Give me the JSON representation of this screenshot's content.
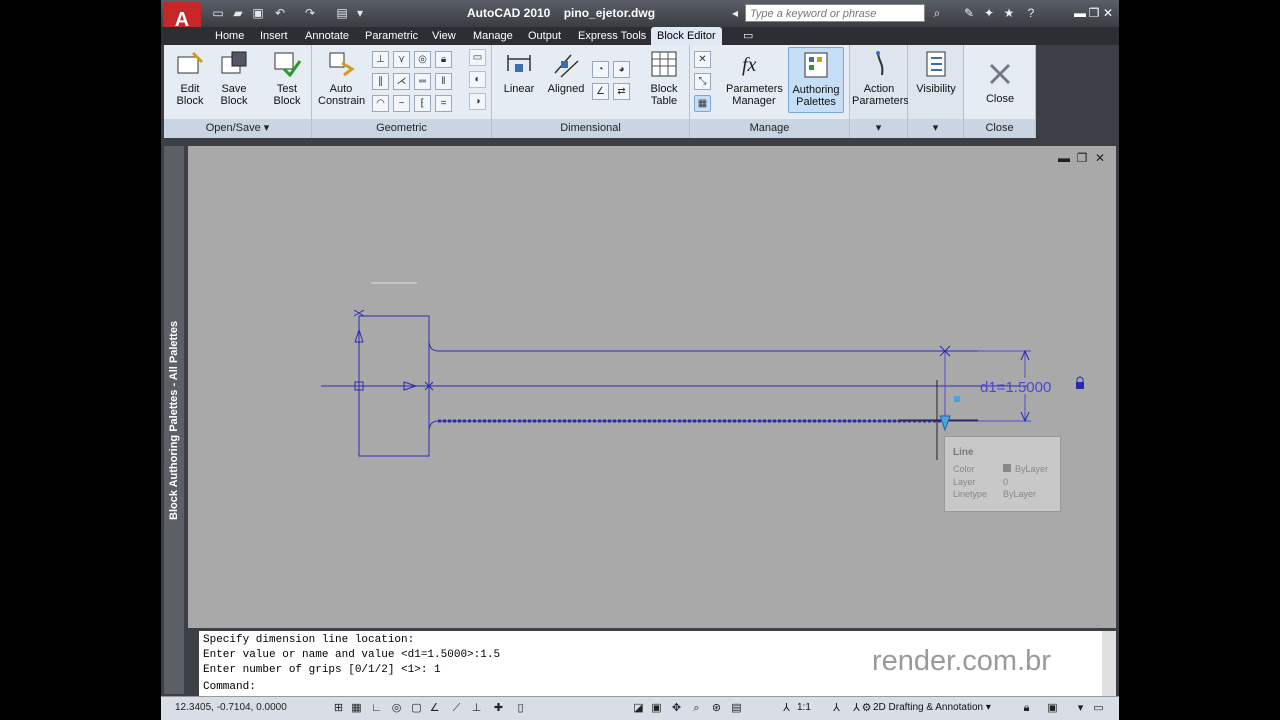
{
  "window": {
    "app_name": "AutoCAD 2010",
    "file_name": "pino_ejetor.dwg",
    "search_placeholder": "Type a keyword or phrase"
  },
  "tabs": [
    "Home",
    "Insert",
    "Annotate",
    "Parametric",
    "View",
    "Manage",
    "Output",
    "Express Tools",
    "Block Editor"
  ],
  "active_tab": "Block Editor",
  "ribbon": {
    "openSave": {
      "title": "Open/Save",
      "edit": "Edit\nBlock",
      "save": "Save\nBlock",
      "test": "Test\nBlock"
    },
    "geometric": {
      "title": "Geometric",
      "auto": "Auto\nConstrain"
    },
    "dimensional": {
      "title": "Dimensional",
      "linear": "Linear",
      "aligned": "Aligned",
      "blockTable": "Block\nTable"
    },
    "manage": {
      "title": "Manage",
      "params": "Parameters\nManager",
      "authoring": "Authoring\nPalettes"
    },
    "action": {
      "label": "Action\nParameters"
    },
    "visibility": {
      "label": "Visibility"
    },
    "close": {
      "title": "Close",
      "label": "Close"
    }
  },
  "palette_label": "Block Authoring Palettes - All Palettes",
  "drawing": {
    "dimension_label": "d1=1.5000"
  },
  "tooltip": {
    "title": "Line",
    "rows": [
      {
        "key": "Color",
        "value": "ByLayer"
      },
      {
        "key": "Layer",
        "value": "0"
      },
      {
        "key": "Linetype",
        "value": "ByLayer"
      }
    ]
  },
  "command_history": [
    "Specify dimension line location:",
    "Enter value or name and value <d1=1.5000>:1.5",
    "Enter number of grips [0/1/2] <1>: 1"
  ],
  "command_prompt": "Command:",
  "status": {
    "coords": "12.3405, -0.7104, 0.0000",
    "scale": "1:1",
    "workspace": "2D Drafting & Annotation"
  },
  "watermark": "render.com.br"
}
